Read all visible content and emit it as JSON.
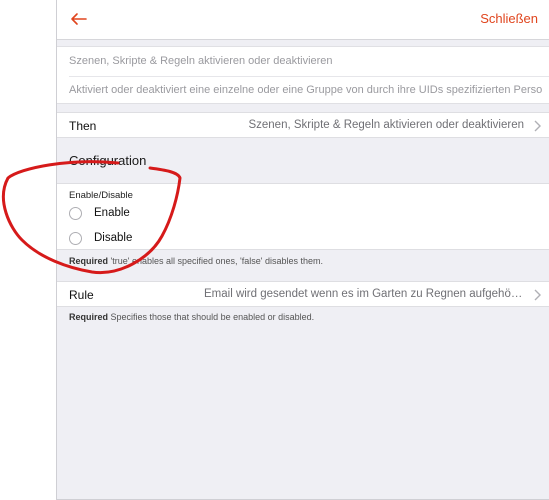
{
  "header": {
    "close_label": "Schließen"
  },
  "info": {
    "name": "Szenen, Skripte & Regeln aktivieren oder deaktivieren",
    "description": "Aktiviert oder deaktiviert eine einzelne oder eine Gruppe von durch ihre UIDs spezifizierten Perso"
  },
  "then_row": {
    "label": "Then",
    "value": "Szenen, Skripte & Regeln aktivieren oder deaktivieren"
  },
  "configuration": {
    "title": "Configuration",
    "field_title": "Enable/Disable",
    "options": [
      "Enable",
      "Disable"
    ],
    "help_required": "Required",
    "help_text": " 'true' enables all specified ones, 'false' disables them."
  },
  "rule_row": {
    "label": "Rule",
    "value": "Email wird gesendet wenn es im Garten zu Regnen aufgehört h...",
    "help_required": "Required",
    "help_text": " Specifies those that should be enabled or disabled."
  },
  "colors": {
    "accent": "#e0451e",
    "annotation": "#d61a1a",
    "background": "#efeff4"
  }
}
